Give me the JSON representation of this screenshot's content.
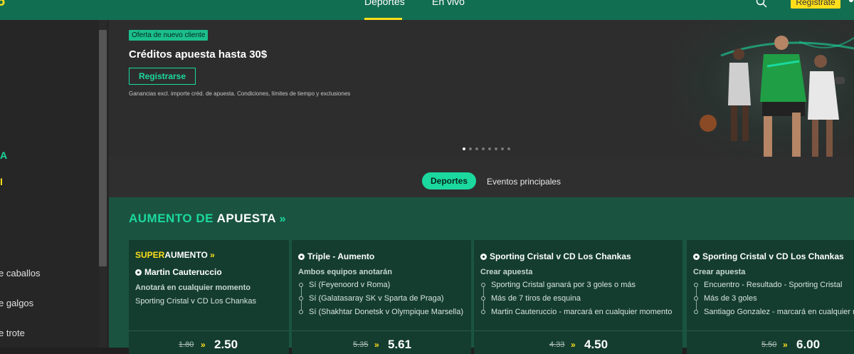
{
  "header": {
    "nav": [
      {
        "label": "Deportes",
        "active": true
      },
      {
        "label": "En vivo",
        "active": false
      }
    ],
    "register_label": "Regístrate",
    "accent_color": "#ffdf1b",
    "brand_color": "#126e51"
  },
  "sidebar": {
    "items": [
      {
        "label": "e caballos"
      },
      {
        "label": "e galgos"
      },
      {
        "label": "e trote"
      }
    ]
  },
  "banner": {
    "tag": "Oferta de nuevo cliente",
    "headline": "Créditos apuesta hasta 30$",
    "cta": "Registrarse",
    "terms": "Ganancias excl. importe créd. de apuesta. Condiciones, límites de tiempo y exclusiones",
    "slide_count": 8,
    "active_slide": 1
  },
  "tabs": [
    {
      "label": "Deportes",
      "active": true
    },
    {
      "label": "Eventos principales",
      "active": false
    }
  ],
  "section": {
    "title_a": "AUMENTO DE",
    "title_b": "APUESTA",
    "chevron": "»"
  },
  "cards": [
    {
      "super_a": "SUPER",
      "super_b": "AUMENTO",
      "title": "Martin Cauteruccio",
      "subtitle": "Anotará en cualquier momento",
      "lines": [
        "Sporting Cristal v CD Los Chankas"
      ],
      "old_odds": "1.80",
      "new_odds": "2.50"
    },
    {
      "title": "Triple - Aumento",
      "subtitle": "Ambos equipos anotarán",
      "legs": [
        "Sí (Feyenoord v Roma)",
        "Sí (Galatasaray SK v Sparta de Praga)",
        "Sí (Shakhtar Donetsk v Olympique Marsella)"
      ],
      "old_odds": "5.35",
      "new_odds": "5.61"
    },
    {
      "title": "Sporting Cristal v CD Los Chankas",
      "subtitle": "Crear apuesta",
      "legs": [
        "Sporting Cristal ganará por 3 goles o más",
        "Más de 7 tiros de esquina",
        "Martin Cauteruccio - marcará en cualquier momento"
      ],
      "old_odds": "4.33",
      "new_odds": "4.50"
    },
    {
      "title": "Sporting Cristal v CD Los Chankas",
      "subtitle": "Crear apuesta",
      "legs": [
        "Encuentro - Resultado - Sporting Cristal",
        "Más de 3 goles",
        "Santiago Gonzalez - marcará en cualquier m"
      ],
      "old_odds": "5.50",
      "new_odds": "6.00"
    }
  ]
}
